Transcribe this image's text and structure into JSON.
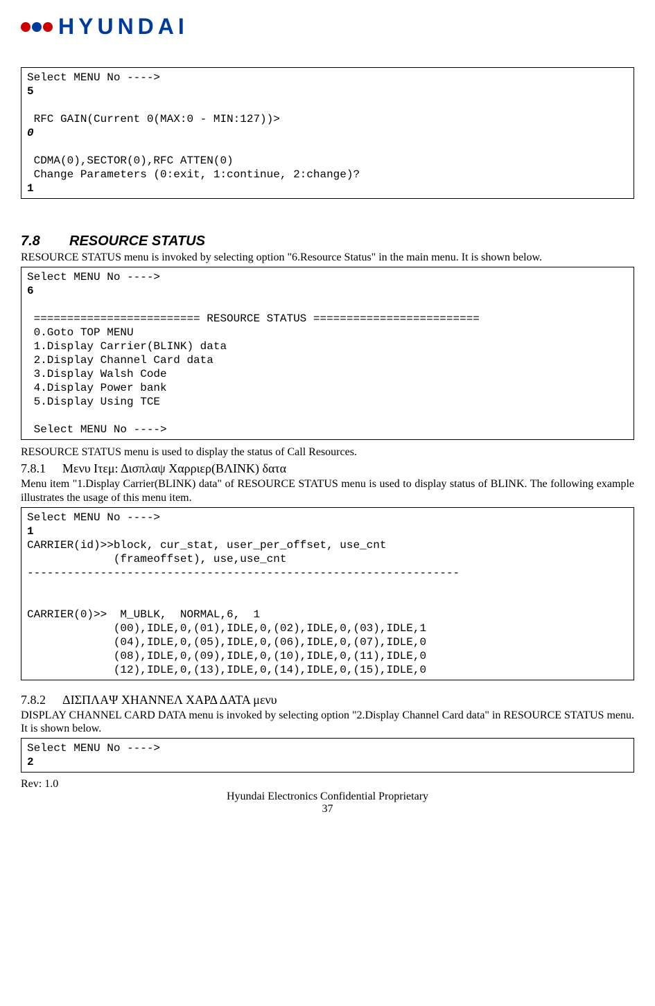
{
  "logo_text": "HYUNDAI",
  "box1": {
    "l1": "Select MENU No ---->",
    "l2": "5",
    "l3": "",
    "l4": " RFC GAIN(Current 0(MAX:0 - MIN:127))>",
    "l5": "0",
    "l6": "",
    "l7": " CDMA(0),SECTOR(0),RFC ATTEN(0)",
    "l8": " Change Parameters (0:exit, 1:continue, 2:change)?",
    "l9": "1"
  },
  "sec78": {
    "num": "7.8",
    "title": "RESOURCE STATUS",
    "intro": "RESOURCE STATUS menu is invoked by selecting option \"6.Resource Status\" in the main menu. It is shown below."
  },
  "box2": {
    "l1": "Select MENU No ---->",
    "l2": "6",
    "l3": "",
    "l4": " ========================= RESOURCE STATUS =========================",
    "l5": " 0.Goto TOP MENU",
    "l6": " 1.Display Carrier(BLINK) data",
    "l7": " 2.Display Channel Card data",
    "l8": " 3.Display Walsh Code",
    "l9": " 4.Display Power bank",
    "l10": " 5.Display Using TCE",
    "l11": "",
    "l12": " Select MENU No ---->"
  },
  "after_box2": "RESOURCE STATUS menu is used to display the status of Call Resources.",
  "sec781": {
    "num": "7.8.1",
    "title": "Μενυ Ιτεμ: Δισπλαψ Χαρριερ(ΒΛΙΝΚ) δατα",
    "p": "Menu item \"1.Display Carrier(BLINK) data\" of RESOURCE STATUS menu is used to display status of BLINK. The following example illustrates the usage of this menu item."
  },
  "box3": {
    "l1": "Select MENU No ---->",
    "l2": "1",
    "l3": "CARRIER(id)>>block, cur_stat, user_per_offset, use_cnt",
    "l4": "             (frameoffset), use,use_cnt",
    "l5": "-----------------------------------------------------------------",
    "l6": "",
    "l7": "",
    "l8": "CARRIER(0)>>  M_UBLK,  NORMAL,6,  1",
    "l9": "             (00),IDLE,0,(01),IDLE,0,(02),IDLE,0,(03),IDLE,1",
    "l10": "             (04),IDLE,0,(05),IDLE,0,(06),IDLE,0,(07),IDLE,0",
    "l11": "             (08),IDLE,0,(09),IDLE,0,(10),IDLE,0,(11),IDLE,0",
    "l12": "             (12),IDLE,0,(13),IDLE,0,(14),IDLE,0,(15),IDLE,0"
  },
  "sec782": {
    "num": "7.8.2",
    "title": "ΔΙΣΠΛΑΨ ΧΗΑΝΝΕΛ ΧΑΡΔ ΔΑΤΑ μενυ",
    "p": "DISPLAY CHANNEL CARD DATA menu is invoked by selecting option \"2.Display Channel Card data\" in RESOURCE STATUS menu. It is shown below."
  },
  "box4": {
    "l1": "Select MENU No ---->",
    "l2": "2"
  },
  "footer": {
    "rev": "Rev: 1.0",
    "conf": "Hyundai Electronics Confidential Proprietary",
    "page": "37"
  }
}
